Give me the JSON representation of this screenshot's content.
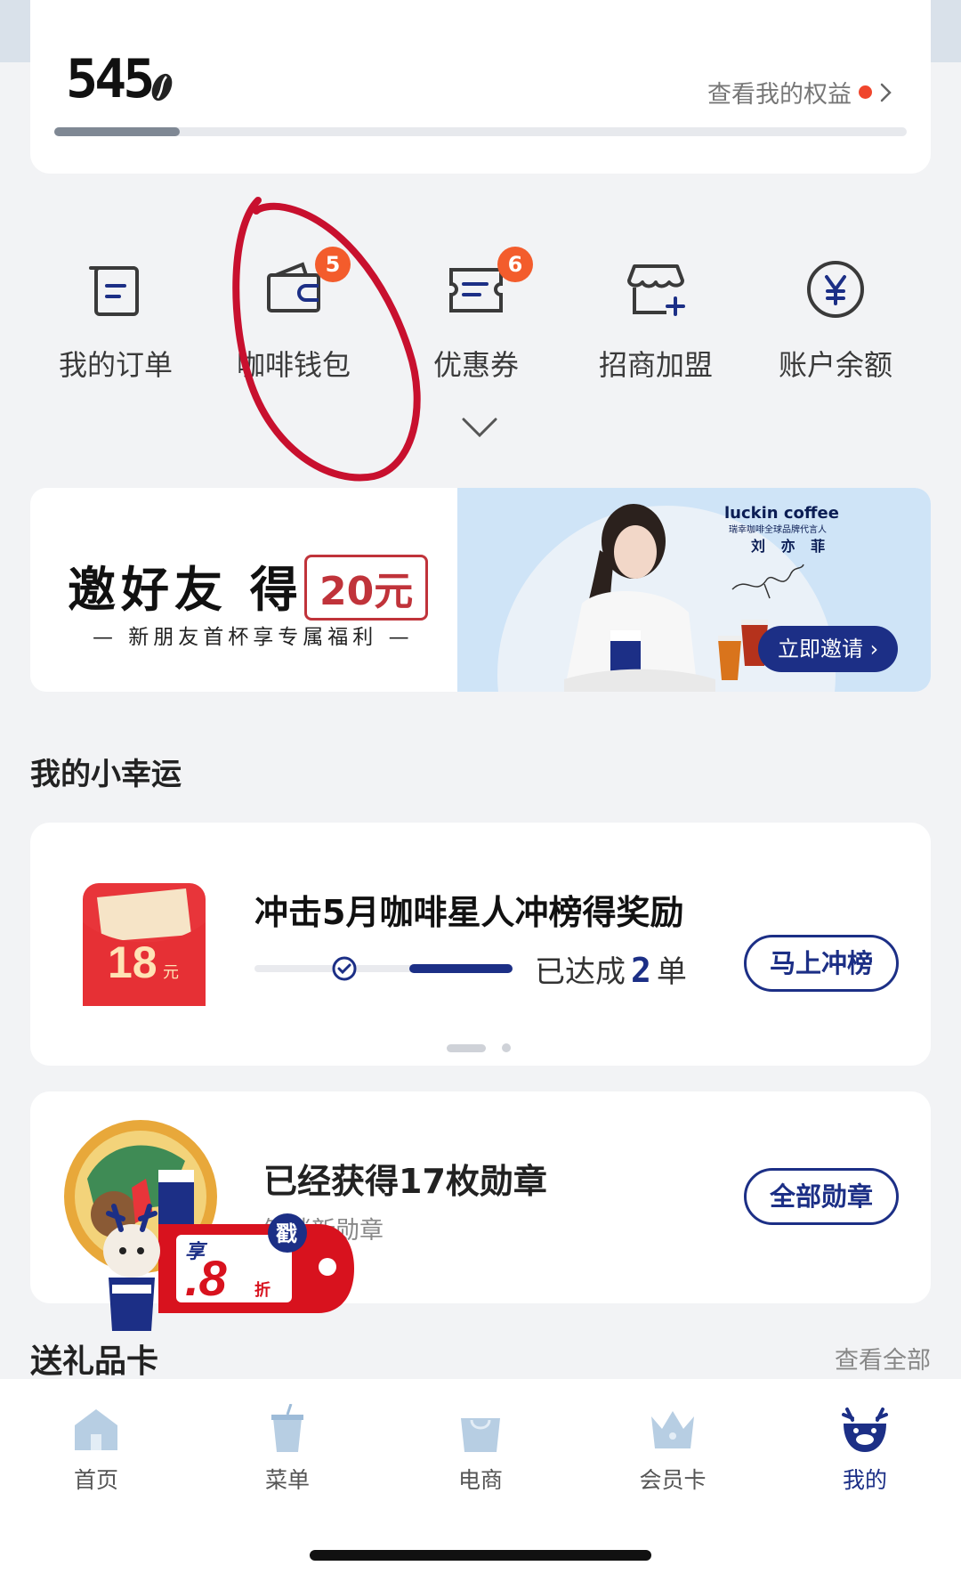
{
  "points": {
    "value": "545",
    "rights_link": "查看我的权益",
    "progress_fraction": 0.147
  },
  "menu": {
    "items": [
      {
        "label": "我的订单",
        "icon": "order-icon"
      },
      {
        "label": "咖啡钱包",
        "icon": "wallet-icon",
        "badge": "5"
      },
      {
        "label": "优惠券",
        "icon": "coupon-icon",
        "badge": "6"
      },
      {
        "label": "招商加盟",
        "icon": "franchise-store-icon"
      },
      {
        "label": "账户余额",
        "icon": "yuan-balance-icon"
      }
    ]
  },
  "invite_banner": {
    "title": "邀好友 得",
    "amount": "20元",
    "subtitle": "— 新朋友首杯享专属福利 —",
    "brand": "luckin coffee",
    "brand_rep": "瑞幸咖啡全球品牌代言人",
    "brand_person": "刘 亦 菲",
    "button": "立即邀请"
  },
  "lucky_section": {
    "title": "我的小幸运",
    "card": {
      "reward_amount": "18",
      "reward_unit": "元",
      "title": "冲击5月咖啡星人冲榜得奖励",
      "status_prefix": "已达成",
      "status_count": "2",
      "status_suffix": "单",
      "button": "马上冲榜",
      "progress_fraction": 0.4
    }
  },
  "medal_card": {
    "title": "已经获得17枚勋章",
    "subtitle": "解锁新勋章",
    "button": "全部勋章"
  },
  "promo": {
    "tag": "享",
    "stamp": "戳",
    "value": ".8",
    "unit": "折"
  },
  "gift_section": {
    "title": "送礼品卡",
    "view_all": "查看全部"
  },
  "tabbar": {
    "tabs": [
      {
        "label": "首页",
        "icon": "home-icon"
      },
      {
        "label": "菜单",
        "icon": "cup-menu-icon"
      },
      {
        "label": "电商",
        "icon": "shopping-bag-icon"
      },
      {
        "label": "会员卡",
        "icon": "crown-icon"
      },
      {
        "label": "我的",
        "icon": "deer-profile-icon",
        "active": true
      }
    ]
  },
  "colors": {
    "brand_blue": "#1c2f86",
    "badge_orange": "#f35c2c",
    "annotation_red": "#c8102e",
    "invite_red": "#c0333a"
  }
}
